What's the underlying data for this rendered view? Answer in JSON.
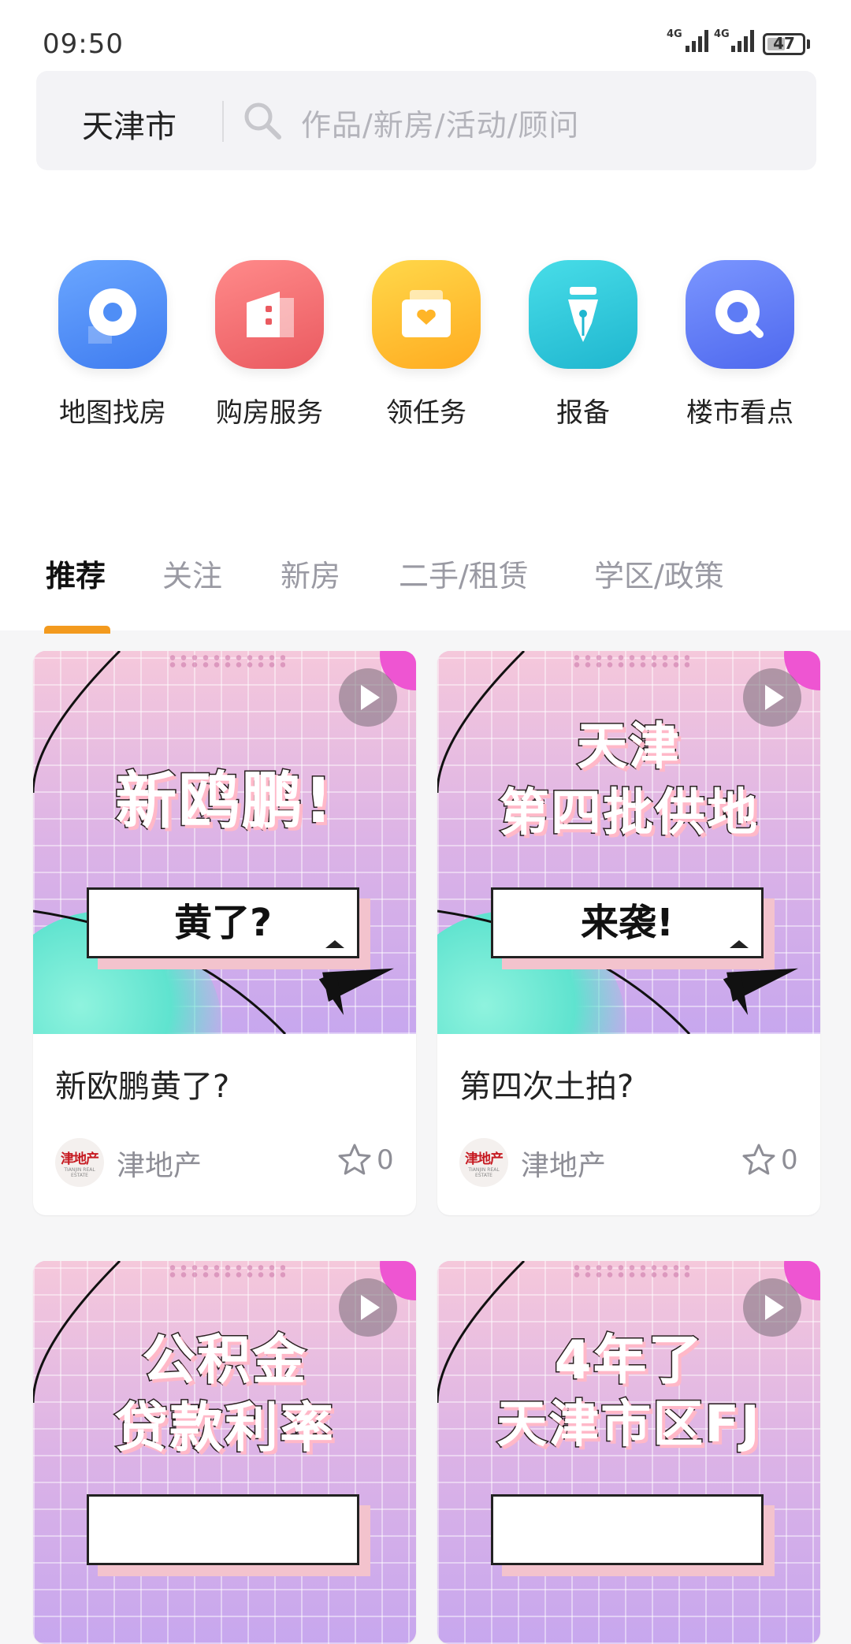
{
  "status_bar": {
    "time": "09:50",
    "network_1": "4G",
    "network_2": "4G",
    "battery": "47"
  },
  "search": {
    "city": "天津市",
    "placeholder": "作品/新房/活动/顾问"
  },
  "quick_actions": [
    {
      "label": "地图找房",
      "icon": "map-pin-icon",
      "color": "#4f8ef6"
    },
    {
      "label": "购房服务",
      "icon": "building-icon",
      "color": "#f2686b"
    },
    {
      "label": "领任务",
      "icon": "task-bag-icon",
      "color": "#ffbf2e"
    },
    {
      "label": "报备",
      "icon": "pen-nib-icon",
      "color": "#2ec8d8"
    },
    {
      "label": "楼市看点",
      "icon": "magnifier-icon",
      "color": "#5e7cf5"
    }
  ],
  "tabs": [
    {
      "label": "推荐",
      "active": true
    },
    {
      "label": "关注",
      "active": false
    },
    {
      "label": "新房",
      "active": false
    },
    {
      "label": "二手/租赁",
      "active": false
    },
    {
      "label": "学区/政策",
      "active": false
    }
  ],
  "feed": [
    {
      "thumb_line1": "",
      "thumb_line2": "新鸥鹏!",
      "banner": "黄了?",
      "title": "新欧鹏黄了?",
      "author": "津地产",
      "avatar_text": "津地产",
      "avatar_sub": "TIANJIN REAL ESTATE",
      "likes": "0"
    },
    {
      "thumb_line1": "天津",
      "thumb_line2": "第四批供地",
      "banner": "来袭!",
      "title": "第四次土拍?",
      "author": "津地产",
      "avatar_text": "津地产",
      "avatar_sub": "TIANJIN REAL ESTATE",
      "likes": "0"
    },
    {
      "thumb_line1": "公积金",
      "thumb_line2": "贷款利率",
      "banner": "",
      "title": "",
      "author": "",
      "avatar_text": "",
      "avatar_sub": "",
      "likes": ""
    },
    {
      "thumb_line1": "4年了",
      "thumb_line2": "天津市区FJ",
      "banner": "",
      "title": "",
      "author": "",
      "avatar_text": "",
      "avatar_sub": "",
      "likes": ""
    }
  ]
}
